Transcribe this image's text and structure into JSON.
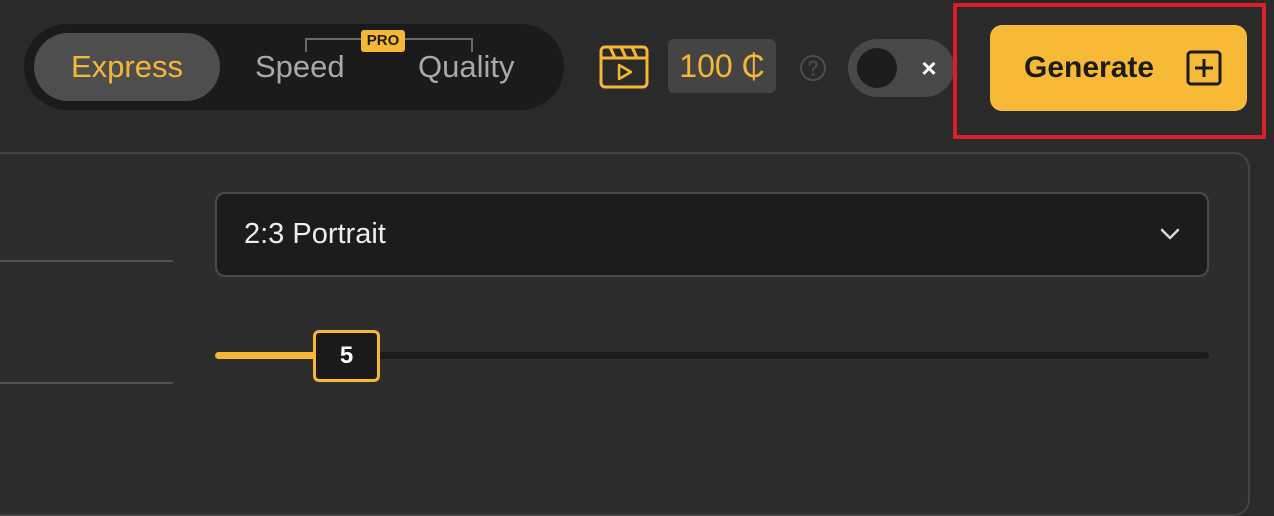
{
  "toolbar": {
    "modes": {
      "express": "Express",
      "speed": "Speed",
      "quality": "Quality",
      "pro_badge": "PRO",
      "selected": "Express"
    },
    "credits": "100 ₵",
    "toggle": {
      "state": "off",
      "off_symbol": "×"
    },
    "generate": {
      "label": "Generate"
    }
  },
  "settings": {
    "aspect_ratio": {
      "value": "2:3 Portrait"
    },
    "slider": {
      "value": "5",
      "fraction": 0.13
    }
  },
  "icons": {
    "clapper": "clapperboard-icon",
    "help": "help-icon",
    "dropdown": "chevron-down-icon",
    "generate": "plus-square-icon"
  },
  "colors": {
    "accent": "#f6b736",
    "highlight": "#d81f2a",
    "background": "#2a2a2a"
  }
}
